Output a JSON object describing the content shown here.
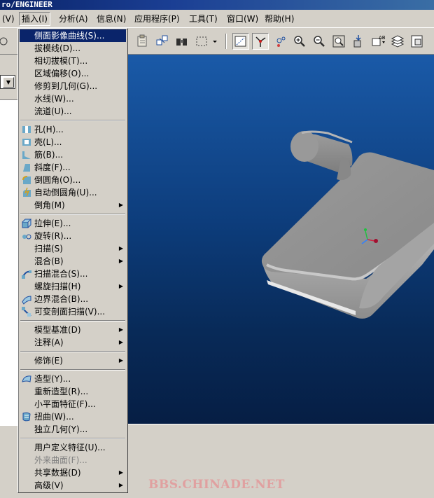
{
  "window": {
    "title": "ro/ENGINEER"
  },
  "menubar": {
    "items": [
      {
        "label": "(V)"
      },
      {
        "label": "插入(I)"
      },
      {
        "label": "分析(A)"
      },
      {
        "label": "信息(N)"
      },
      {
        "label": "应用程序(P)"
      },
      {
        "label": "工具(T)"
      },
      {
        "label": "窗口(W)"
      },
      {
        "label": "帮助(H)"
      }
    ]
  },
  "toolbar": {
    "icons": [
      "paste-icon",
      "copy-icon",
      "find-icon",
      "select-box-icon",
      "view-orient-icon",
      "datum-axis-toggle-icon",
      "spin-center-icon",
      "zoom-in-icon",
      "zoom-out-icon",
      "refit-icon",
      "datum-points-icon",
      "annotation-icon",
      "layers-icon",
      "model-tree-icon"
    ]
  },
  "insert_menu": {
    "items": [
      {
        "label": "侧面影像曲线(S)...",
        "highlighted": true
      },
      {
        "label": "拔模线(D)..."
      },
      {
        "label": "相切拔模(T)..."
      },
      {
        "label": "区域偏移(O)..."
      },
      {
        "label": "修剪到几何(G)..."
      },
      {
        "label": "水线(W)..."
      },
      {
        "label": "流道(U)..."
      },
      {
        "label": "孔(H)...",
        "icon": "hole-icon"
      },
      {
        "label": "壳(L)...",
        "icon": "shell-icon"
      },
      {
        "label": "筋(B)...",
        "icon": "rib-icon"
      },
      {
        "label": "斜度(F)...",
        "icon": "draft-icon"
      },
      {
        "label": "倒圆角(O)...",
        "icon": "round-icon"
      },
      {
        "label": "自动倒圆角(U)...",
        "icon": "auto-round-icon"
      },
      {
        "label": "倒角(M)",
        "submenu": true
      },
      {
        "label": "拉伸(E)...",
        "icon": "extrude-icon"
      },
      {
        "label": "旋转(R)...",
        "icon": "revolve-icon"
      },
      {
        "label": "扫描(S)",
        "submenu": true
      },
      {
        "label": "混合(B)",
        "submenu": true
      },
      {
        "label": "扫描混合(S)...",
        "icon": "swept-blend-icon"
      },
      {
        "label": "螺旋扫描(H)",
        "submenu": true
      },
      {
        "label": "边界混合(B)...",
        "icon": "boundary-blend-icon"
      },
      {
        "label": "可变剖面扫描(V)...",
        "icon": "variable-section-sweep-icon"
      },
      {
        "label": "模型基准(D)",
        "submenu": true
      },
      {
        "label": "注释(A)",
        "submenu": true
      },
      {
        "label": "修饰(E)",
        "submenu": true
      },
      {
        "label": "造型(Y)...",
        "icon": "style-icon"
      },
      {
        "label": "重新造型(R)..."
      },
      {
        "label": "小平面特征(F)..."
      },
      {
        "label": "扭曲(W)...",
        "icon": "warp-icon"
      },
      {
        "label": "独立几何(Y)..."
      },
      {
        "label": "用户定义特征(U)..."
      },
      {
        "label": "外来曲面(F)...",
        "disabled": true
      },
      {
        "label": "共享数据(D)",
        "submenu": true
      },
      {
        "label": "高级(V)",
        "submenu": true
      }
    ]
  },
  "watermark": {
    "text": "BBS.CHINADE.NET"
  },
  "colors": {
    "menu_highlight": "#0a246a",
    "viewport_top": "#1a5aa8",
    "viewport_bottom": "#061e44",
    "model_gray": "#a8a8a8",
    "watermark": "#e0a0a0"
  }
}
